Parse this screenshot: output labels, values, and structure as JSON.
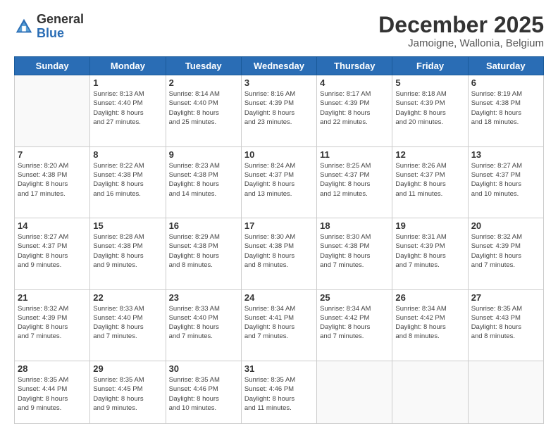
{
  "header": {
    "logo_general": "General",
    "logo_blue": "Blue",
    "month_title": "December 2025",
    "location": "Jamoigne, Wallonia, Belgium"
  },
  "days_of_week": [
    "Sunday",
    "Monday",
    "Tuesday",
    "Wednesday",
    "Thursday",
    "Friday",
    "Saturday"
  ],
  "weeks": [
    [
      {
        "day": "",
        "info": ""
      },
      {
        "day": "1",
        "info": "Sunrise: 8:13 AM\nSunset: 4:40 PM\nDaylight: 8 hours\nand 27 minutes."
      },
      {
        "day": "2",
        "info": "Sunrise: 8:14 AM\nSunset: 4:40 PM\nDaylight: 8 hours\nand 25 minutes."
      },
      {
        "day": "3",
        "info": "Sunrise: 8:16 AM\nSunset: 4:39 PM\nDaylight: 8 hours\nand 23 minutes."
      },
      {
        "day": "4",
        "info": "Sunrise: 8:17 AM\nSunset: 4:39 PM\nDaylight: 8 hours\nand 22 minutes."
      },
      {
        "day": "5",
        "info": "Sunrise: 8:18 AM\nSunset: 4:39 PM\nDaylight: 8 hours\nand 20 minutes."
      },
      {
        "day": "6",
        "info": "Sunrise: 8:19 AM\nSunset: 4:38 PM\nDaylight: 8 hours\nand 18 minutes."
      }
    ],
    [
      {
        "day": "7",
        "info": "Sunrise: 8:20 AM\nSunset: 4:38 PM\nDaylight: 8 hours\nand 17 minutes."
      },
      {
        "day": "8",
        "info": "Sunrise: 8:22 AM\nSunset: 4:38 PM\nDaylight: 8 hours\nand 16 minutes."
      },
      {
        "day": "9",
        "info": "Sunrise: 8:23 AM\nSunset: 4:38 PM\nDaylight: 8 hours\nand 14 minutes."
      },
      {
        "day": "10",
        "info": "Sunrise: 8:24 AM\nSunset: 4:37 PM\nDaylight: 8 hours\nand 13 minutes."
      },
      {
        "day": "11",
        "info": "Sunrise: 8:25 AM\nSunset: 4:37 PM\nDaylight: 8 hours\nand 12 minutes."
      },
      {
        "day": "12",
        "info": "Sunrise: 8:26 AM\nSunset: 4:37 PM\nDaylight: 8 hours\nand 11 minutes."
      },
      {
        "day": "13",
        "info": "Sunrise: 8:27 AM\nSunset: 4:37 PM\nDaylight: 8 hours\nand 10 minutes."
      }
    ],
    [
      {
        "day": "14",
        "info": "Sunrise: 8:27 AM\nSunset: 4:37 PM\nDaylight: 8 hours\nand 9 minutes."
      },
      {
        "day": "15",
        "info": "Sunrise: 8:28 AM\nSunset: 4:38 PM\nDaylight: 8 hours\nand 9 minutes."
      },
      {
        "day": "16",
        "info": "Sunrise: 8:29 AM\nSunset: 4:38 PM\nDaylight: 8 hours\nand 8 minutes."
      },
      {
        "day": "17",
        "info": "Sunrise: 8:30 AM\nSunset: 4:38 PM\nDaylight: 8 hours\nand 8 minutes."
      },
      {
        "day": "18",
        "info": "Sunrise: 8:30 AM\nSunset: 4:38 PM\nDaylight: 8 hours\nand 7 minutes."
      },
      {
        "day": "19",
        "info": "Sunrise: 8:31 AM\nSunset: 4:39 PM\nDaylight: 8 hours\nand 7 minutes."
      },
      {
        "day": "20",
        "info": "Sunrise: 8:32 AM\nSunset: 4:39 PM\nDaylight: 8 hours\nand 7 minutes."
      }
    ],
    [
      {
        "day": "21",
        "info": "Sunrise: 8:32 AM\nSunset: 4:39 PM\nDaylight: 8 hours\nand 7 minutes."
      },
      {
        "day": "22",
        "info": "Sunrise: 8:33 AM\nSunset: 4:40 PM\nDaylight: 8 hours\nand 7 minutes."
      },
      {
        "day": "23",
        "info": "Sunrise: 8:33 AM\nSunset: 4:40 PM\nDaylight: 8 hours\nand 7 minutes."
      },
      {
        "day": "24",
        "info": "Sunrise: 8:34 AM\nSunset: 4:41 PM\nDaylight: 8 hours\nand 7 minutes."
      },
      {
        "day": "25",
        "info": "Sunrise: 8:34 AM\nSunset: 4:42 PM\nDaylight: 8 hours\nand 7 minutes."
      },
      {
        "day": "26",
        "info": "Sunrise: 8:34 AM\nSunset: 4:42 PM\nDaylight: 8 hours\nand 8 minutes."
      },
      {
        "day": "27",
        "info": "Sunrise: 8:35 AM\nSunset: 4:43 PM\nDaylight: 8 hours\nand 8 minutes."
      }
    ],
    [
      {
        "day": "28",
        "info": "Sunrise: 8:35 AM\nSunset: 4:44 PM\nDaylight: 8 hours\nand 9 minutes."
      },
      {
        "day": "29",
        "info": "Sunrise: 8:35 AM\nSunset: 4:45 PM\nDaylight: 8 hours\nand 9 minutes."
      },
      {
        "day": "30",
        "info": "Sunrise: 8:35 AM\nSunset: 4:46 PM\nDaylight: 8 hours\nand 10 minutes."
      },
      {
        "day": "31",
        "info": "Sunrise: 8:35 AM\nSunset: 4:46 PM\nDaylight: 8 hours\nand 11 minutes."
      },
      {
        "day": "",
        "info": ""
      },
      {
        "day": "",
        "info": ""
      },
      {
        "day": "",
        "info": ""
      }
    ]
  ]
}
